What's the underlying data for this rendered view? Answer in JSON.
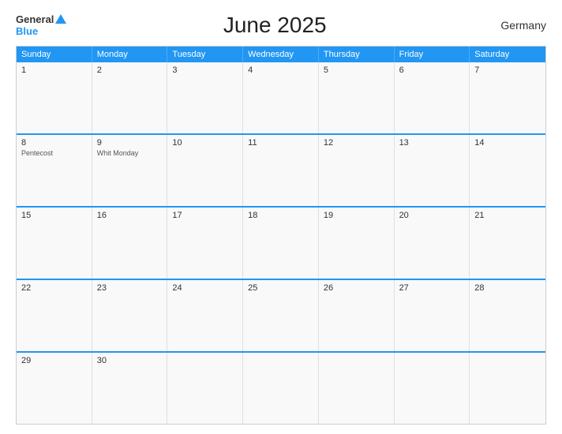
{
  "header": {
    "title": "June 2025",
    "country": "Germany",
    "logo": {
      "general": "General",
      "blue": "Blue"
    }
  },
  "dayHeaders": [
    "Sunday",
    "Monday",
    "Tuesday",
    "Wednesday",
    "Thursday",
    "Friday",
    "Saturday"
  ],
  "weeks": [
    [
      {
        "day": "1",
        "holiday": ""
      },
      {
        "day": "2",
        "holiday": ""
      },
      {
        "day": "3",
        "holiday": ""
      },
      {
        "day": "4",
        "holiday": ""
      },
      {
        "day": "5",
        "holiday": ""
      },
      {
        "day": "6",
        "holiday": ""
      },
      {
        "day": "7",
        "holiday": ""
      }
    ],
    [
      {
        "day": "8",
        "holiday": "Pentecost"
      },
      {
        "day": "9",
        "holiday": "Whit Monday"
      },
      {
        "day": "10",
        "holiday": ""
      },
      {
        "day": "11",
        "holiday": ""
      },
      {
        "day": "12",
        "holiday": ""
      },
      {
        "day": "13",
        "holiday": ""
      },
      {
        "day": "14",
        "holiday": ""
      }
    ],
    [
      {
        "day": "15",
        "holiday": ""
      },
      {
        "day": "16",
        "holiday": ""
      },
      {
        "day": "17",
        "holiday": ""
      },
      {
        "day": "18",
        "holiday": ""
      },
      {
        "day": "19",
        "holiday": ""
      },
      {
        "day": "20",
        "holiday": ""
      },
      {
        "day": "21",
        "holiday": ""
      }
    ],
    [
      {
        "day": "22",
        "holiday": ""
      },
      {
        "day": "23",
        "holiday": ""
      },
      {
        "day": "24",
        "holiday": ""
      },
      {
        "day": "25",
        "holiday": ""
      },
      {
        "day": "26",
        "holiday": ""
      },
      {
        "day": "27",
        "holiday": ""
      },
      {
        "day": "28",
        "holiday": ""
      }
    ],
    [
      {
        "day": "29",
        "holiday": ""
      },
      {
        "day": "30",
        "holiday": ""
      },
      {
        "day": "",
        "holiday": ""
      },
      {
        "day": "",
        "holiday": ""
      },
      {
        "day": "",
        "holiday": ""
      },
      {
        "day": "",
        "holiday": ""
      },
      {
        "day": "",
        "holiday": ""
      }
    ]
  ]
}
